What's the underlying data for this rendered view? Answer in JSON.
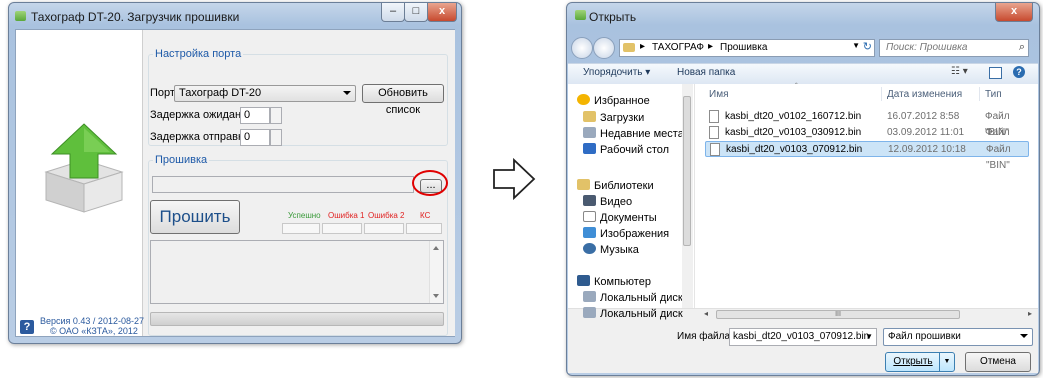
{
  "loader": {
    "title": "Тахограф DT-20. Загрузчик прошивки",
    "minimize": "–",
    "maximize": "□",
    "close": "x",
    "port_group": "Настройка порта",
    "port_label": "Порт",
    "port_value": "Тахограф DT-20",
    "refresh_button": "Обновить список",
    "wait_delay_label": "Задержка ожидания",
    "wait_delay_value": "0",
    "send_delay_label": "Задержка отправки",
    "send_delay_value": "0",
    "firmware_group": "Прошивка",
    "browse_button": "...",
    "flash_button": "Прошить",
    "status_success": "Успешно",
    "status_error1": "Ошибка 1",
    "status_error2": "Ошибка 2",
    "status_ks": "КС",
    "version": "Версия 0.43 / 2012-08-27",
    "copyright": "© ОАО «КЗТА», 2012",
    "help_icon_text": "?",
    "colors": {
      "error": "#e02020",
      "success": "#3a9a3a",
      "group_title": "#1e5aa8",
      "highlight_circle": "#e00000"
    }
  },
  "arrow_icon": "outline-right-arrow-icon",
  "open_dialog": {
    "title": "Открыть",
    "close": "x",
    "breadcrumb": [
      "ТАХОГРАФ",
      "Прошивка"
    ],
    "search_placeholder": "Поиск: Прошивка",
    "organize": "Упорядочить ▾",
    "new_folder": "Новая папка",
    "columns": {
      "name": "Имя",
      "date": "Дата изменения",
      "type": "Тип"
    },
    "nav": {
      "favorites": "Избранное",
      "downloads": "Загрузки",
      "recent": "Недавние места",
      "desktop": "Рабочий стол",
      "libraries": "Библиотеки",
      "video": "Видео",
      "documents": "Документы",
      "images": "Изображения",
      "music": "Музыка",
      "computer": "Компьютер",
      "local_disk1": "Локальный диск",
      "local_disk2": "Локальный диск"
    },
    "files": [
      {
        "name": "kasbi_dt20_v0102_160712.bin",
        "date": "16.07.2012 8:58",
        "type": "Файл \"BIN\""
      },
      {
        "name": "kasbi_dt20_v0103_030912.bin",
        "date": "03.09.2012 11:01",
        "type": "Файл \"BIN\""
      },
      {
        "name": "kasbi_dt20_v0103_070912.bin",
        "date": "12.09.2012 10:18",
        "type": "Файл \"BIN\""
      }
    ],
    "filename_label": "Имя файла:",
    "filename_value": "kasbi_dt20_v0103_070912.bin",
    "filter_value": "Файл прошивки",
    "open_button": "Открыть",
    "cancel_button": "Отмена",
    "scroll_mark": "III"
  }
}
